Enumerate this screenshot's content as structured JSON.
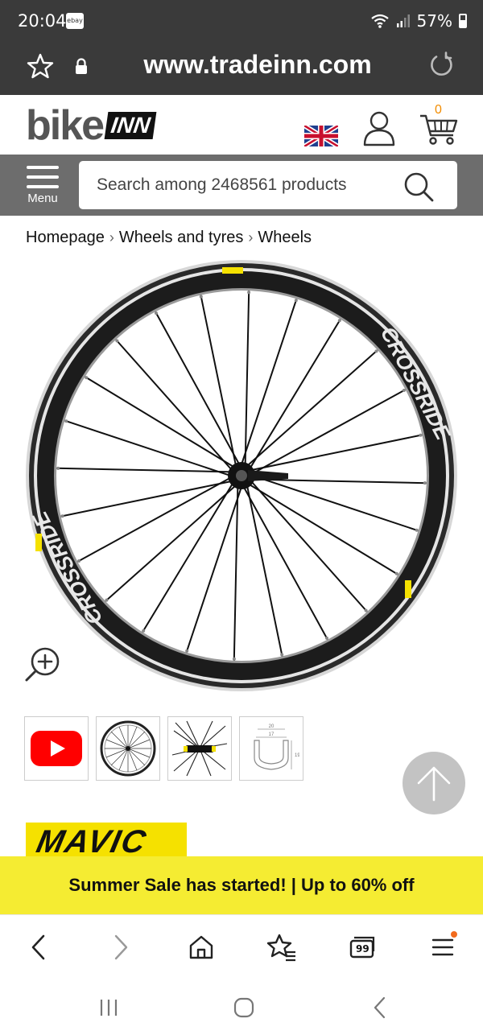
{
  "status_bar": {
    "time": "20:04",
    "notification_app": "ebay",
    "battery": "57%"
  },
  "browser": {
    "url": "www.tradeinn.com"
  },
  "site": {
    "logo_main": "bike",
    "logo_suffix": "INN",
    "cart_count": "0",
    "menu_label": "Menu",
    "search_placeholder": "Search among 2468561 products"
  },
  "breadcrumb": [
    "Homepage",
    "Wheels and tyres",
    "Wheels"
  ],
  "product": {
    "brand": "MAVIC",
    "rim_text": "CROSSRIDE",
    "thumbnails": [
      "video-thumbnail",
      "wheel-front-thumbnail",
      "hub-closeup-thumbnail",
      "rim-profile-thumbnail"
    ],
    "rim_profile_labels": [
      "20",
      "17",
      "19"
    ]
  },
  "promo": {
    "sale_text": "Summer Sale has started! | Up to 60% off"
  },
  "bottom_nav": {
    "tabs_count": "99"
  },
  "colors": {
    "chrome_dark": "#3a3a3a",
    "search_bg": "#6d6d6d",
    "sale_yellow": "#f5ec32",
    "brand_yellow": "#f5e100",
    "cart_accent": "#f28c00",
    "youtube_red": "#ff0000"
  }
}
